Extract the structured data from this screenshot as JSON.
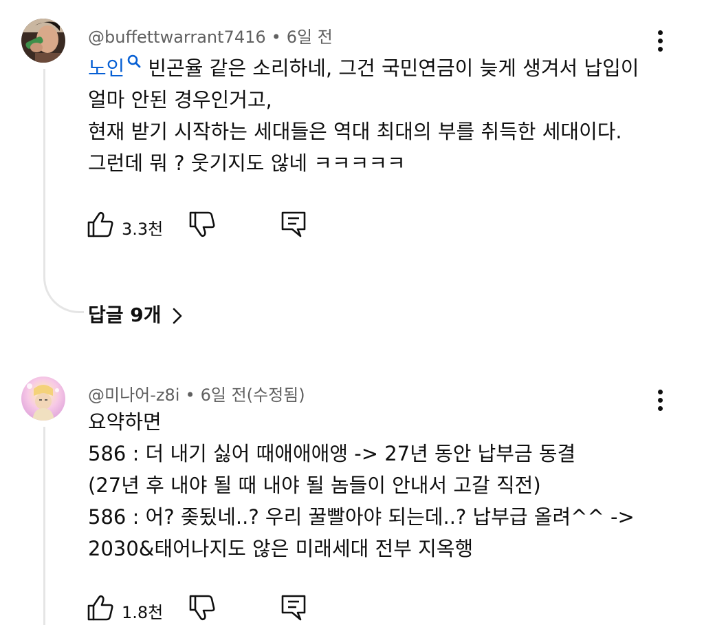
{
  "comments": [
    {
      "author": "@buffettwarrant7416",
      "time": "6일 전",
      "linked_term": "노인",
      "lines": [
        "빈곤율 같은 소리하네, 그건 국민연금이 늦게 생겨서 납입이",
        "얼마 안된 경우인거고,",
        "현재 받기 시작하는 세대들은 역대 최대의 부를 취득한 세대이다.",
        "그런데 뭐 ? 웃기지도 않네 ㅋㅋㅋㅋㅋ"
      ],
      "likes": "3.3천",
      "replies_label": "답글 9개"
    },
    {
      "author": "@미나어-z8i",
      "time": "6일 전(수정됨)",
      "lines": [
        "요약하면",
        "586 : 더 내기 싫어 때애애애앵 -> 27년 동안 납부금 동결",
        "(27년 후 내야 될 때 내야 될 놈들이 안내서 고갈 직전)",
        "586 : 어? 좆됬네..? 우리 꿀빨아야 되는데..? 납부급 올려^^  ->",
        "2030&태어나지도 않은 미래세대 전부 지옥행"
      ],
      "likes": "1.8천"
    }
  ],
  "icons": {
    "like": "thumbs-up-icon",
    "dislike": "thumbs-down-icon",
    "reply": "comment-reply-icon",
    "menu": "more-vert-icon",
    "search": "search-icon",
    "chevron": "chevron-right-icon"
  },
  "colors": {
    "link": "#065fd4",
    "meta": "#606060",
    "text": "#0f0f0f",
    "thread": "#e5e5e5"
  }
}
